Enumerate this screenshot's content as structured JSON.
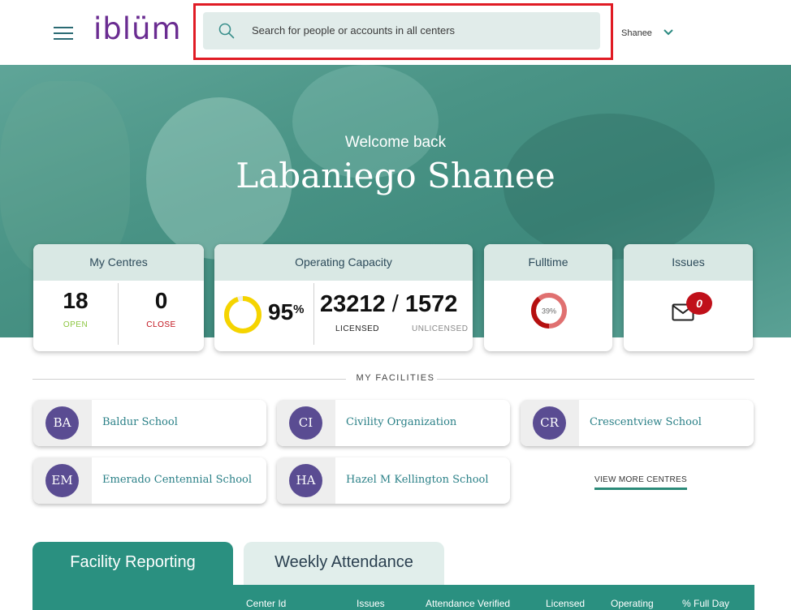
{
  "header": {
    "logo": "iblüm",
    "search_placeholder": "Search for people or accounts in all centers",
    "user_name": "Shanee"
  },
  "hero": {
    "welcome": "Welcome back",
    "name": "Labaniego Shanee"
  },
  "cards": {
    "centres": {
      "title": "My Centres",
      "open_value": "18",
      "open_label": "OPEN",
      "close_value": "0",
      "close_label": "CLOSE"
    },
    "capacity": {
      "title": "Operating Capacity",
      "percent": "95",
      "percent_sign": "%",
      "licensed_value": "23212",
      "separator": "/",
      "unlicensed_value": "1572",
      "licensed_label": "LICENSED",
      "unlicensed_label": "UNLICENSED"
    },
    "fulltime": {
      "title": "Fulltime",
      "value": "39%"
    },
    "issues": {
      "title": "Issues",
      "count": "0"
    }
  },
  "facilities": {
    "title": "MY FACILITIES",
    "items": [
      {
        "initials": "BA",
        "name": "Baldur School"
      },
      {
        "initials": "CI",
        "name": "Civility Organization"
      },
      {
        "initials": "CR",
        "name": "Crescentview School"
      },
      {
        "initials": "EM",
        "name": "Emerado Centennial School"
      },
      {
        "initials": "HA",
        "name": "Hazel M Kellington School"
      }
    ],
    "view_more": "VIEW MORE CENTRES"
  },
  "tabs": [
    {
      "label": "Facility Reporting",
      "active": true
    },
    {
      "label": "Weekly Attendance",
      "active": false
    }
  ],
  "table": {
    "columns": [
      "Center Id",
      "Issues",
      "Attendance Verified",
      "Licensed",
      "Operating",
      "% Full Day"
    ]
  },
  "colors": {
    "brand": "#6a2c91",
    "teal": "#2a9080",
    "open_green": "#8cc63f",
    "close_red": "#c0101a",
    "gauge_yellow": "#f5d400"
  },
  "icons": [
    "menu-icon",
    "search-icon",
    "chevron-down-icon",
    "mail-icon"
  ]
}
